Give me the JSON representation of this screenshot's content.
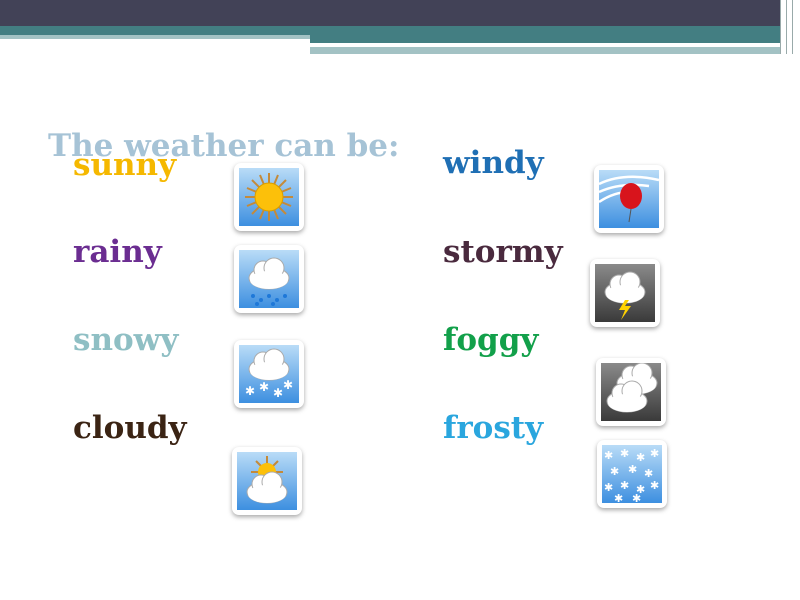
{
  "title": "The weather can be:",
  "left_words": [
    {
      "label": "sunny",
      "color": "#f5b800",
      "icon": "sun-icon"
    },
    {
      "label": "rainy",
      "color": "#6b2d91",
      "icon": "rain-cloud-icon"
    },
    {
      "label": "snowy",
      "color": "#8fbfc4",
      "icon": "snow-cloud-icon"
    },
    {
      "label": "cloudy",
      "color": "#3b2414",
      "icon": "sun-cloud-icon"
    }
  ],
  "right_words": [
    {
      "label": "windy",
      "color": "#1f6fb4",
      "icon": "wind-balloon-icon"
    },
    {
      "label": "stormy",
      "color": "#4a2a3e",
      "icon": "thunderstorm-icon"
    },
    {
      "label": "foggy",
      "color": "#12a04a",
      "icon": "fog-cloud-icon"
    },
    {
      "label": "frosty",
      "color": "#2aa6de",
      "icon": "frost-snowflakes-icon"
    }
  ]
}
